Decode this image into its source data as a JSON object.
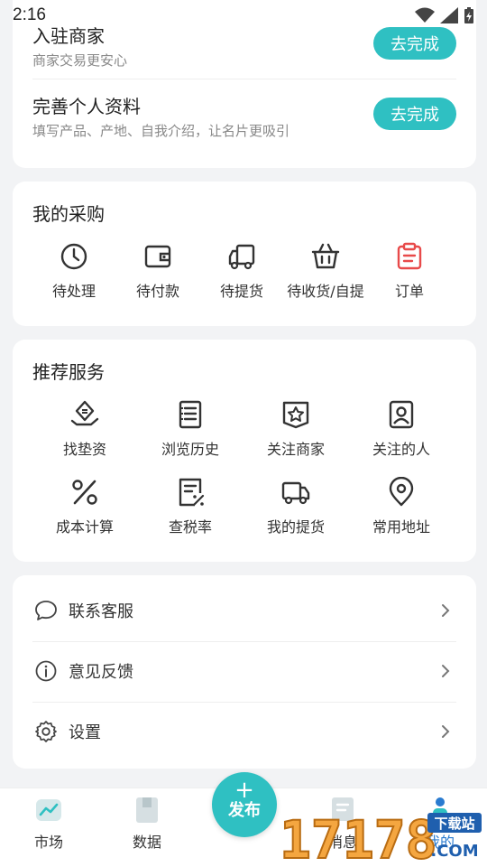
{
  "status_bar": {
    "time": "2:16"
  },
  "tasks": [
    {
      "title": "入驻商家",
      "subtitle": "商家交易更安心",
      "button": "去完成"
    },
    {
      "title": "完善个人资料",
      "subtitle": "填写产品、产地、自我介绍，让名片更吸引",
      "button": "去完成"
    }
  ],
  "purchase": {
    "title": "我的采购",
    "items": [
      {
        "label": "待处理",
        "icon": "clock-icon"
      },
      {
        "label": "待付款",
        "icon": "wallet-icon"
      },
      {
        "label": "待提货",
        "icon": "truck-icon"
      },
      {
        "label": "待收货/自提",
        "icon": "basket-icon"
      },
      {
        "label": "订单",
        "icon": "clipboard-icon",
        "color": "#e84a4a"
      }
    ]
  },
  "services": {
    "title": "推荐服务",
    "items": [
      {
        "label": "找垫资",
        "icon": "funding-icon"
      },
      {
        "label": "浏览历史",
        "icon": "history-icon"
      },
      {
        "label": "关注商家",
        "icon": "star-shop-icon"
      },
      {
        "label": "关注的人",
        "icon": "person-icon"
      },
      {
        "label": "成本计算",
        "icon": "percent-icon"
      },
      {
        "label": "查税率",
        "icon": "tax-icon"
      },
      {
        "label": "我的提货",
        "icon": "delivery-icon"
      },
      {
        "label": "常用地址",
        "icon": "location-icon"
      }
    ]
  },
  "settings": [
    {
      "label": "联系客服",
      "icon": "chat-icon"
    },
    {
      "label": "意见反馈",
      "icon": "info-icon"
    },
    {
      "label": "设置",
      "icon": "gear-icon"
    }
  ],
  "bottom_nav": {
    "items": [
      {
        "label": "市场",
        "icon": "market-icon"
      },
      {
        "label": "数据",
        "icon": "data-icon"
      },
      {
        "label": "消息",
        "icon": "message-icon"
      },
      {
        "label": "我的",
        "icon": "me-icon",
        "active": true
      }
    ],
    "publish": "发布"
  },
  "watermark": {
    "text": "17178",
    "sub_top": "下载站",
    "sub_bottom": ".COM"
  },
  "colors": {
    "accent": "#2fc0c2",
    "order_red": "#e84a4a",
    "background": "#f2f3f5"
  }
}
